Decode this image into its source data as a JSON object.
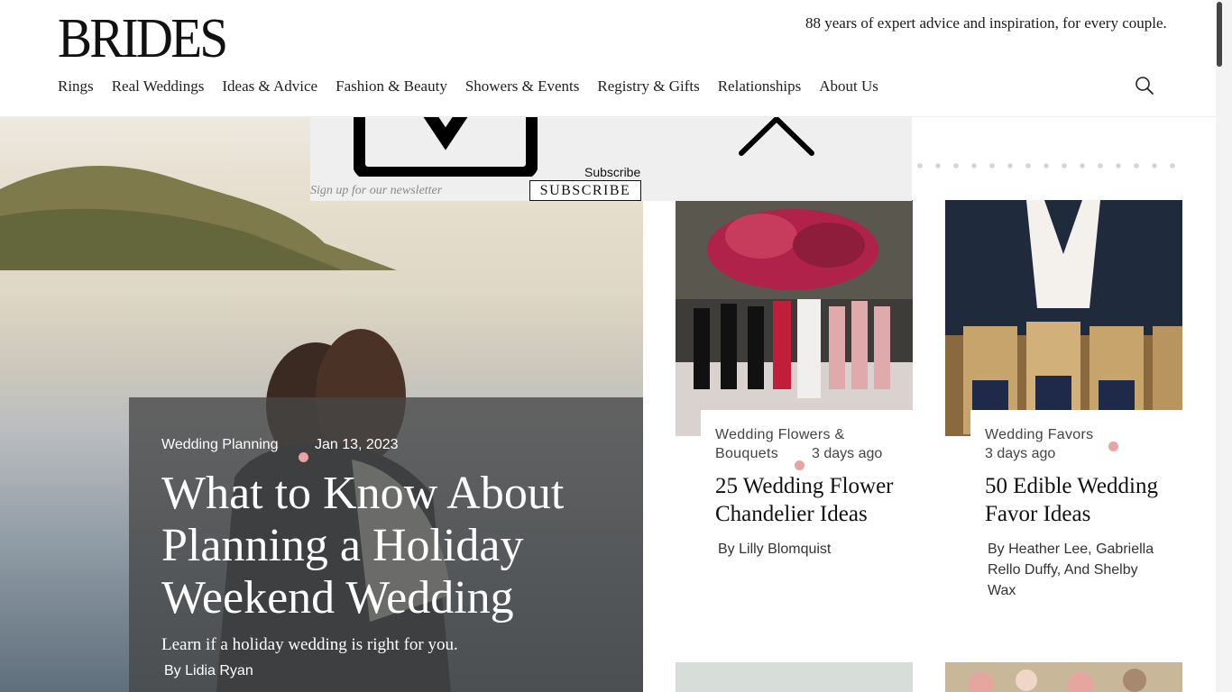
{
  "header": {
    "logo": "BRIDES",
    "tagline": "88 years of expert advice and inspiration, for every couple.",
    "nav": [
      "Rings",
      "Real Weddings",
      "Ideas & Advice",
      "Fashion & Beauty",
      "Showers & Events",
      "Registry & Gifts",
      "Relationships",
      "About Us"
    ],
    "search_icon": "search-icon"
  },
  "newsletter": {
    "subscribe_label": "Subscribe",
    "input_placeholder": "Sign up for our newsletter",
    "button_label": "SUBSCRIBE",
    "icons": [
      "email-icon",
      "chevron-up-icon"
    ]
  },
  "hero": {
    "category": "Wedding Planning",
    "date": "Jan 13, 2023",
    "title": "What to Know About Planning a Holiday Weekend Wedding",
    "dek": "Learn if a holiday wedding is right for you.",
    "byline": "By Lidia Ryan"
  },
  "cards": [
    {
      "category": "Wedding Flowers & Bouquets",
      "date": "3 days ago",
      "title": "25 Wedding Flower Chandelier Ideas",
      "byline": "By Lilly Blomquist"
    },
    {
      "category": "Wedding Favors",
      "date": "3 days ago",
      "title": "50 Edible Wedding Favor Ideas",
      "byline": "By Heather Lee, Gabriella Rello Duffy, And Shelby Wax"
    }
  ],
  "colors": {
    "accent_dot": "#e9a3a0",
    "overlay_panel": "#efefef",
    "hero_card": "#464646"
  }
}
